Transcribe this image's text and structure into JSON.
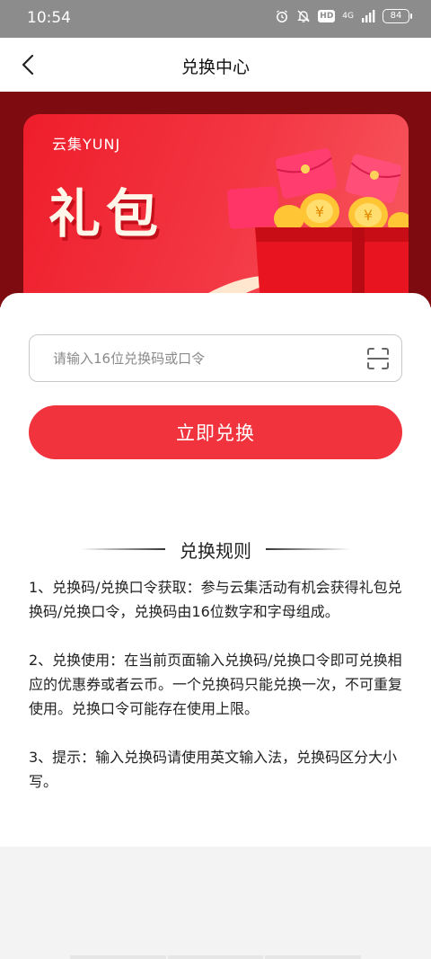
{
  "status_bar": {
    "time": "10:54",
    "network": "4G",
    "hd": "HD",
    "battery": "84",
    "icons": [
      "alarm-icon",
      "bell-muted-icon",
      "hd-icon",
      "signal-icon",
      "battery-icon"
    ]
  },
  "nav": {
    "title": "兑换中心",
    "back_icon": "chevron-left-icon"
  },
  "banner": {
    "brand": "云集YUNJ",
    "headline": "礼包",
    "illustration": "gift-box-red-envelopes-coins"
  },
  "redeem": {
    "placeholder": "请输入16位兑换码或口令",
    "value": "",
    "scan_icon": "scan-icon",
    "button_label": "立即兑换"
  },
  "rules": {
    "title": "兑换规则",
    "items": [
      "1、兑换码/兑换口令获取：参与云集活动有机会获得礼包兑换码/兑换口令，兑换码由16位数字和字母组成。",
      "2、兑换使用：在当前页面输入兑换码/兑换口令即可兑换相应的优惠券或者云币。一个兑换码只能兑换一次，不可重复使用。兑换口令可能存在使用上限。",
      "3、提示：输入兑换码请使用英文输入法，兑换码区分大小写。"
    ]
  },
  "colors": {
    "accent": "#f0333d",
    "banner_bg": "#7e0b10",
    "card_red": "#ef1d2b",
    "statusbar": "#8c8c8c"
  }
}
